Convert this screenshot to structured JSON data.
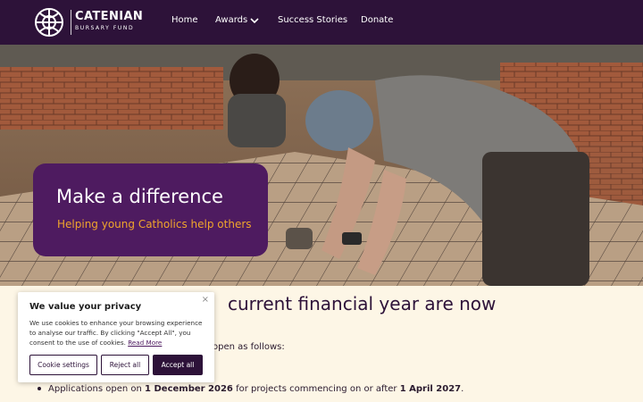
{
  "brand": {
    "name": "CATENIAN",
    "sub": "BURSARY FUND",
    "logo_icon": "celtic-knot-icon"
  },
  "nav": {
    "home": "Home",
    "awards": "Awards",
    "success_stories": "Success Stories",
    "donate": "Donate"
  },
  "hero": {
    "title": "Make a difference",
    "subtitle": "Helping young Catholics help others"
  },
  "content": {
    "heading_visible": "current financial year are now",
    "line_visible": "open as follows:",
    "bullet": {
      "prefix": "Applications open on ",
      "date_open": "1 December 2026",
      "middle": " for projects commencing on or after ",
      "date_start": "1 April 2027",
      "suffix": "."
    }
  },
  "cookie": {
    "title": "We value your privacy",
    "text": "We use cookies to enhance your browsing experience to analyse our traffic. By clicking \"Accept All\", you consent to the use of cookies.",
    "read_more": "Read More",
    "close": "×",
    "settings": "Cookie settings",
    "reject": "Reject all",
    "accept": "Accept all"
  },
  "colors": {
    "nav_bg": "#2d1239",
    "callout_bg": "#4e1b60",
    "callout_accent": "#f0a52c",
    "page_bg": "#fdf6e6"
  }
}
